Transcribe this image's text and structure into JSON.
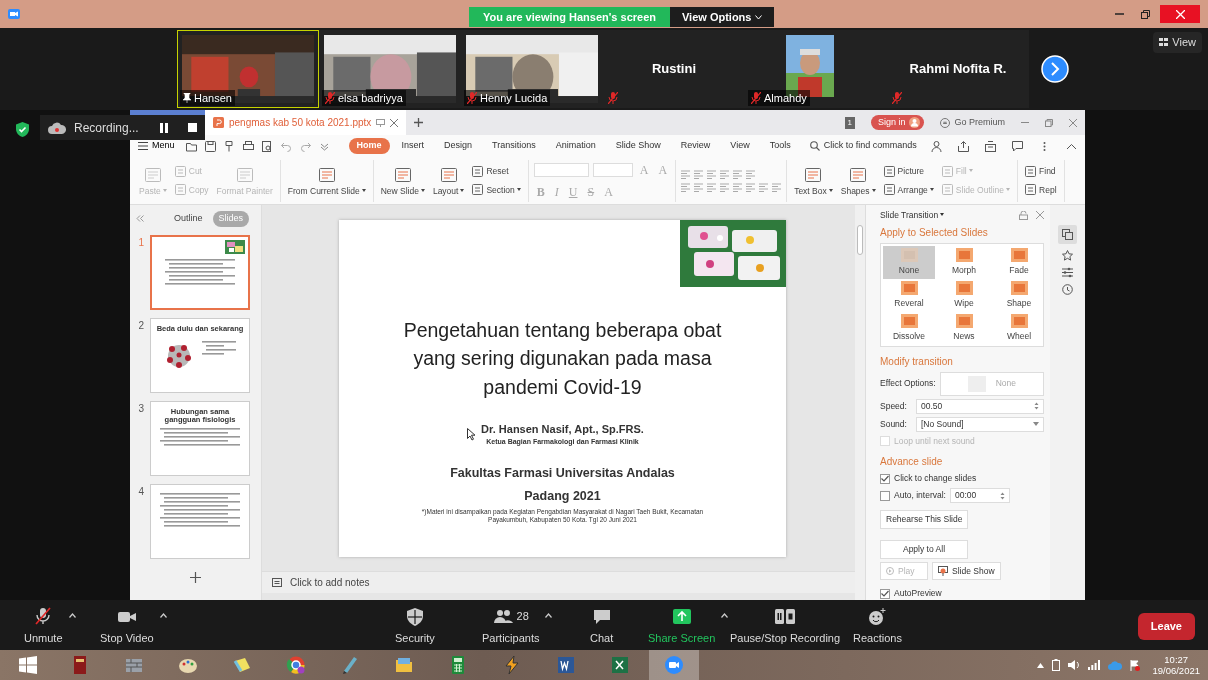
{
  "title_bar": {
    "banner": "You are viewing Hansen's screen",
    "view_options": "View Options"
  },
  "participants": [
    {
      "name": "Hansen",
      "kind": "video",
      "pinned": true,
      "muted": false,
      "active": true
    },
    {
      "name": "elsa badriyya",
      "kind": "video",
      "pinned": false,
      "muted": true,
      "active": false
    },
    {
      "name": "Henny Lucida",
      "kind": "video",
      "pinned": false,
      "muted": true,
      "active": false
    },
    {
      "name": "Rustini",
      "kind": "name",
      "pinned": false,
      "muted": true,
      "active": false
    },
    {
      "name": "Almahdy",
      "pinned": false,
      "muted": true,
      "active": false
    },
    {
      "name": "Rahmi Nofita R.",
      "kind": "name",
      "pinned": false,
      "muted": true,
      "active": false
    }
  ],
  "view_button": "View",
  "recording": {
    "label": "Recording..."
  },
  "wps": {
    "doc_tab": "pengmas kab 50 kota 2021.pptx",
    "page_badge": "1",
    "sign_in": "Sign in",
    "go_premium": "Go Premium",
    "menu": "Menu",
    "ribbon_tabs": [
      {
        "label": "Home",
        "selected": true
      },
      {
        "label": "Insert",
        "selected": false
      },
      {
        "label": "Design",
        "selected": false
      },
      {
        "label": "Transitions",
        "selected": false
      },
      {
        "label": "Animation",
        "selected": false
      },
      {
        "label": "Slide Show",
        "selected": false
      },
      {
        "label": "Review",
        "selected": false
      },
      {
        "label": "View",
        "selected": false
      },
      {
        "label": "Tools",
        "selected": false
      }
    ],
    "find_commands": "Click to find commands",
    "ribbon_groups": [
      {
        "kind": "buttons",
        "items": [
          {
            "label": "Paste",
            "kind": "large",
            "disabled": true,
            "dropdown": true
          },
          {
            "label": "Cut",
            "kind": "small",
            "disabled": true,
            "dropdown": false
          },
          {
            "label": "Copy",
            "kind": "small",
            "disabled": true,
            "dropdown": false
          },
          {
            "label": "Format Painter",
            "kind": "large",
            "disabled": true,
            "dropdown": false
          }
        ]
      },
      {
        "kind": "buttons",
        "items": [
          {
            "label": "From Current Slide",
            "kind": "large",
            "disabled": false,
            "dropdown": true
          }
        ]
      },
      {
        "kind": "buttons",
        "items": [
          {
            "label": "New Slide",
            "kind": "large",
            "disabled": false,
            "dropdown": true
          },
          {
            "label": "Layout",
            "kind": "large",
            "disabled": false,
            "dropdown": true
          },
          {
            "label": "Reset",
            "kind": "small",
            "disabled": false,
            "dropdown": false
          },
          {
            "label": "Section",
            "kind": "small",
            "disabled": false,
            "dropdown": true
          }
        ]
      },
      {
        "kind": "font",
        "size_buttons": [
          "A",
          "A"
        ],
        "style_buttons": [
          "B",
          "I",
          "U",
          "S",
          "A"
        ]
      },
      {
        "kind": "paragraph"
      },
      {
        "kind": "buttons",
        "items": [
          {
            "label": "Text Box",
            "kind": "large",
            "disabled": false,
            "dropdown": true
          },
          {
            "label": "Shapes",
            "kind": "large",
            "disabled": false,
            "dropdown": true
          },
          {
            "label": "Picture",
            "kind": "small",
            "disabled": false,
            "dropdown": false
          },
          {
            "label": "Arrange",
            "kind": "small",
            "disabled": false,
            "dropdown": true
          },
          {
            "label": "Fill",
            "kind": "small",
            "disabled": true,
            "dropdown": true
          },
          {
            "label": "Slide Outline",
            "kind": "small",
            "disabled": true,
            "dropdown": true
          }
        ]
      },
      {
        "kind": "buttons",
        "items": [
          {
            "label": "Find",
            "kind": "small",
            "disabled": false,
            "dropdown": false
          },
          {
            "label": "Repl",
            "kind": "small",
            "disabled": false,
            "dropdown": false
          }
        ]
      }
    ],
    "panel_tabs": [
      {
        "label": "Outline",
        "selected": false
      },
      {
        "label": "Slides",
        "selected": true
      }
    ],
    "thumbnails": [
      {
        "number": "1",
        "selected": true,
        "kind": "title"
      },
      {
        "number": "2",
        "selected": false,
        "title": "Beda dulu dan sekarang"
      },
      {
        "number": "3",
        "selected": false,
        "kind": "text",
        "title": "Hubungan sama gangguan fisiologis"
      },
      {
        "number": "4",
        "selected": false,
        "kind": "text"
      }
    ],
    "notes_placeholder": "Click to add notes",
    "slide": {
      "title": "Pengetahuan tentang beberapa obat yang sering digunakan pada masa pandemi Covid-19",
      "author": "Dr. Hansen Nasif, Apt., Sp.FRS.",
      "role": "Ketua Bagian Farmakologi dan Farmasi Klinik",
      "faculty": "Fakultas Farmasi Universitas Andalas",
      "place": "Padang 2021",
      "footnote": "*)Materi ini disampaikan pada Kegiatan Pengabdian Masyarakat di Nagari Taeh Bukit, Kecamatan Payakumbuh, Kabupaten 50 Kota. Tgl 20 Juni 2021"
    },
    "transition_pane": {
      "title": "Slide Transition",
      "apply_heading": "Apply to Selected Slides",
      "transitions": [
        {
          "label": "None",
          "selected": true
        },
        {
          "label": "Morph",
          "selected": false
        },
        {
          "label": "Fade",
          "selected": false
        },
        {
          "label": "Reveral",
          "selected": false
        },
        {
          "label": "Wipe",
          "selected": false
        },
        {
          "label": "Shape",
          "selected": false
        },
        {
          "label": "Dissolve",
          "selected": false
        },
        {
          "label": "News",
          "selected": false
        },
        {
          "label": "Wheel",
          "selected": false
        }
      ],
      "modify_heading": "Modify transition",
      "effect_label": "Effect Options:",
      "effect_value": "None",
      "speed_label": "Speed:",
      "speed_value": "00.50",
      "sound_label": "Sound:",
      "sound_value": "[No Sound]",
      "loop": {
        "label": "Loop until next sound",
        "checked": false,
        "disabled": true
      },
      "advance_heading": "Advance slide",
      "click_change": {
        "label": "Click to change slides",
        "checked": true
      },
      "auto": {
        "label": "Auto, interval:",
        "checked": false,
        "value": "00:00"
      },
      "rehearse": "Rehearse This Slide",
      "apply_all": "Apply to All",
      "play": "Play",
      "slide_show": "Slide Show",
      "autopreview": {
        "label": "AutoPreview",
        "checked": true
      }
    }
  },
  "meeting_controls": [
    {
      "label": "Unmute",
      "kind": "mic",
      "caret": true
    },
    {
      "label": "Stop Video",
      "kind": "video",
      "caret": true
    },
    {
      "label": "Security",
      "kind": "shield",
      "caret": false
    },
    {
      "label": "Participants",
      "kind": "people",
      "caret": true,
      "count": "28"
    },
    {
      "label": "Chat",
      "kind": "chat",
      "caret": false
    },
    {
      "label": "Share Screen",
      "kind": "share",
      "caret": true
    },
    {
      "label": "Pause/Stop Recording",
      "kind": "record",
      "caret": false
    },
    {
      "label": "Reactions",
      "kind": "react",
      "caret": false
    }
  ],
  "leave": "Leave",
  "taskbar": {
    "apps": [
      {
        "kind": "book",
        "active": false
      },
      {
        "kind": "bricks",
        "active": false
      },
      {
        "kind": "palette",
        "active": false
      },
      {
        "kind": "notes",
        "active": false
      },
      {
        "kind": "browser",
        "active": false
      },
      {
        "kind": "pen",
        "active": false
      },
      {
        "kind": "folder",
        "active": false
      },
      {
        "kind": "calculator",
        "active": false
      },
      {
        "kind": "bolt",
        "active": false
      },
      {
        "kind": "word",
        "active": false
      },
      {
        "kind": "excel",
        "active": false
      },
      {
        "kind": "camera",
        "active": true
      }
    ],
    "time": "10:27",
    "date": "19/06/2021"
  }
}
